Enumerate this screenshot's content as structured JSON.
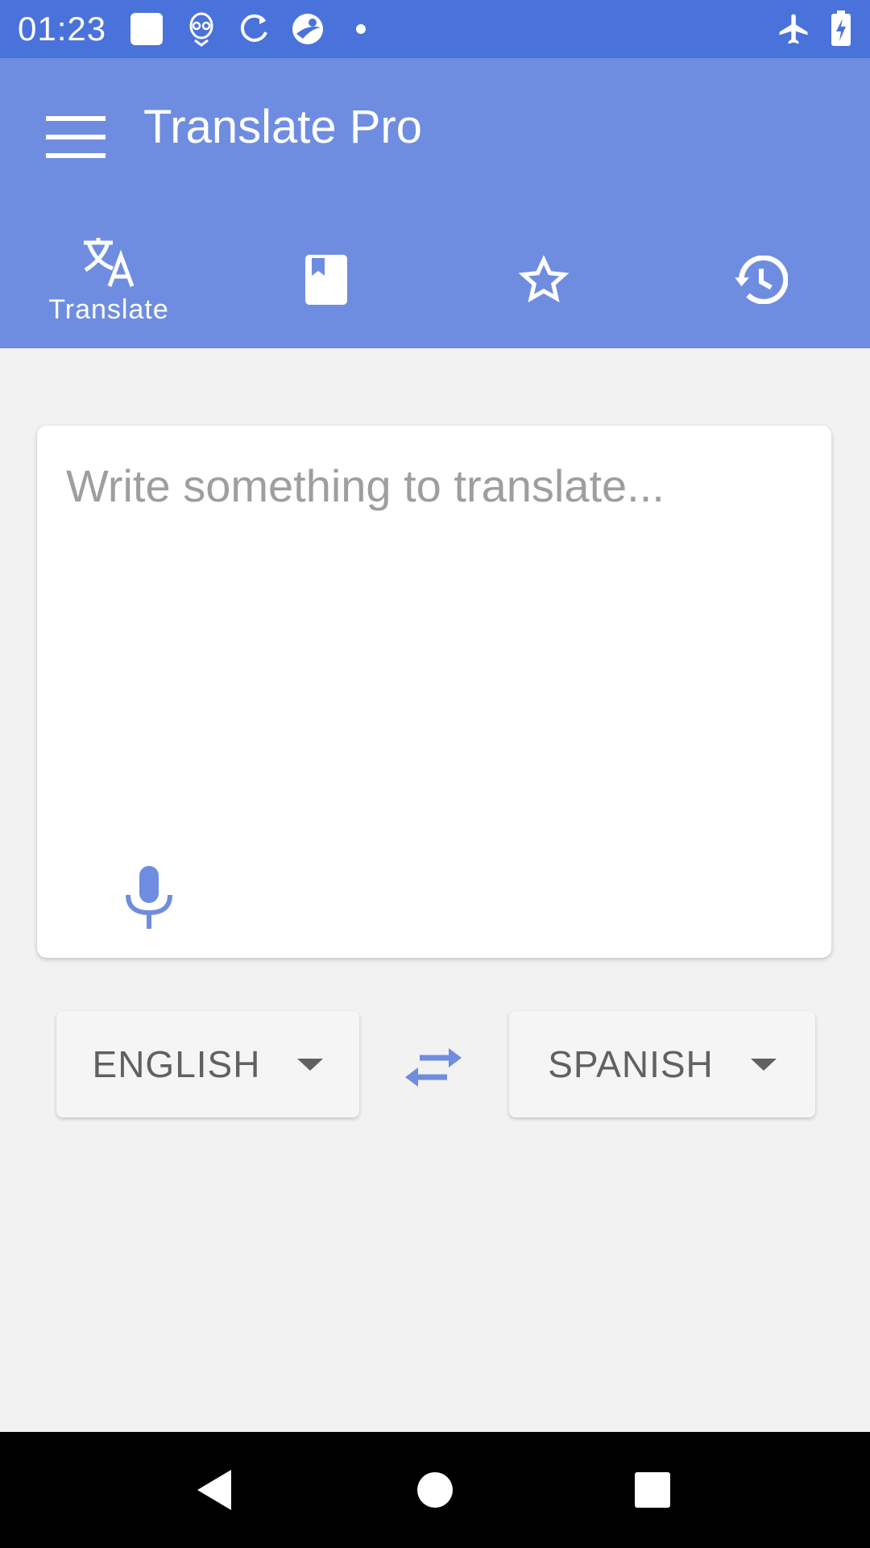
{
  "status_bar": {
    "time": "01:23",
    "left_icons": [
      "notification-square-icon",
      "alien-icon",
      "sync-icon",
      "browser-icon",
      "dot-icon"
    ],
    "right_icons": [
      "airplane-mode-icon",
      "battery-charging-icon"
    ]
  },
  "app_bar": {
    "menu_icon": "hamburger-menu-icon",
    "title": "Translate Pro",
    "tabs": [
      {
        "icon": "translate-icon",
        "label": "Translate",
        "selected": true
      },
      {
        "icon": "book-icon",
        "label": "",
        "selected": false
      },
      {
        "icon": "star-outline-icon",
        "label": "",
        "selected": false
      },
      {
        "icon": "history-icon",
        "label": "",
        "selected": false
      }
    ]
  },
  "input": {
    "value": "",
    "placeholder": "Write something to translate...",
    "mic_icon": "microphone-icon"
  },
  "languages": {
    "source": "ENGLISH",
    "target": "SPANISH",
    "swap_icon": "swap-arrows-icon"
  },
  "nav_bar": {
    "icons": [
      "back-icon",
      "home-icon",
      "recents-icon"
    ]
  },
  "colors": {
    "status_bar": "#4a72db",
    "app_bar": "#6f8de0",
    "accent": "#6f8de0",
    "background": "#f2f2f2",
    "language_text": "#616161",
    "placeholder": "#9e9e9e"
  }
}
